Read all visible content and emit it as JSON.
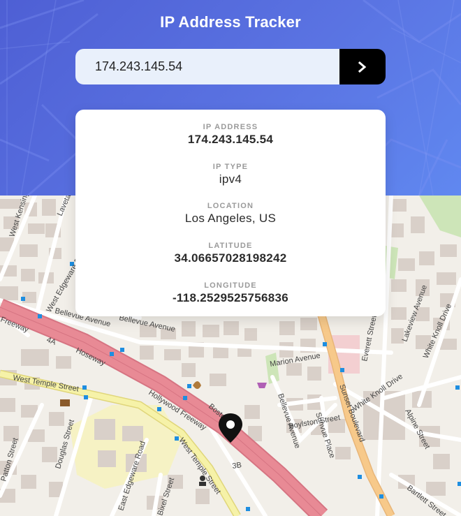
{
  "header": {
    "title": "IP Address Tracker"
  },
  "search": {
    "value": "174.243.145.54",
    "submit_icon": "chevron-right-icon"
  },
  "info": {
    "ip_address": {
      "label": "IP ADDRESS",
      "value": "174.243.145.54"
    },
    "ip_type": {
      "label": "IP TYPE",
      "value": "ipv4"
    },
    "location": {
      "label": "LOCATION",
      "value": "Los Angeles, US"
    },
    "latitude": {
      "label": "LATITUDE",
      "value": "34.06657028198242"
    },
    "longitude": {
      "label": "LONGITUDE",
      "value": "-118.2529525756836"
    }
  },
  "map": {
    "marker_icon": "location-pin-icon",
    "streets": {
      "hollywood_freeway": "Hollywood Freeway",
      "freeway": "Freeway",
      "hoseway": "Hoseway",
      "west_temple": "West Temple Street",
      "west_temple_2": "West Temple Street",
      "bellevue_avenue": "Bellevue Avenue",
      "bellevue_avenue_2": "Bellevue Avenue",
      "marion_avenue": "Marion Avenue",
      "boylston_street": "Boylston Street",
      "sunset_boulevard": "Sunset Boulevard",
      "white_knoll_drive": "White Knoll Drive",
      "alpine_street": "Alpine Street",
      "everett_street": "Everett Street",
      "lakeview_avenue": "Lakeview Avenue",
      "white_knoll_drive_2": "White Knoll Drive",
      "patton_street": "Patton Street",
      "douglas_street": "Douglas Street",
      "east_edgeware_road": "East Edgeware Road",
      "west_edgeware_road": "West Edgeware Road",
      "west_kensington": "West Kensington",
      "laveta_terrace": "Laveta Te",
      "bartlett_street": "Bartlett Street",
      "bixel_street": "Bixel Street",
      "sunvue_place": "Sunvue Place",
      "bellevue_ave_short": "Bellevue Avenue",
      "exit_4a": "4A",
      "exit_3b": "3B",
      "boston": "Bosto"
    }
  },
  "colors": {
    "header_start": "#4e5fd4",
    "header_end": "#6088f0",
    "freeway": "#e88a95",
    "boulevard": "#f7c98a",
    "park": "#f6f2c4",
    "map_bg": "#f2efe9",
    "buildings": "#d9d0c9"
  }
}
